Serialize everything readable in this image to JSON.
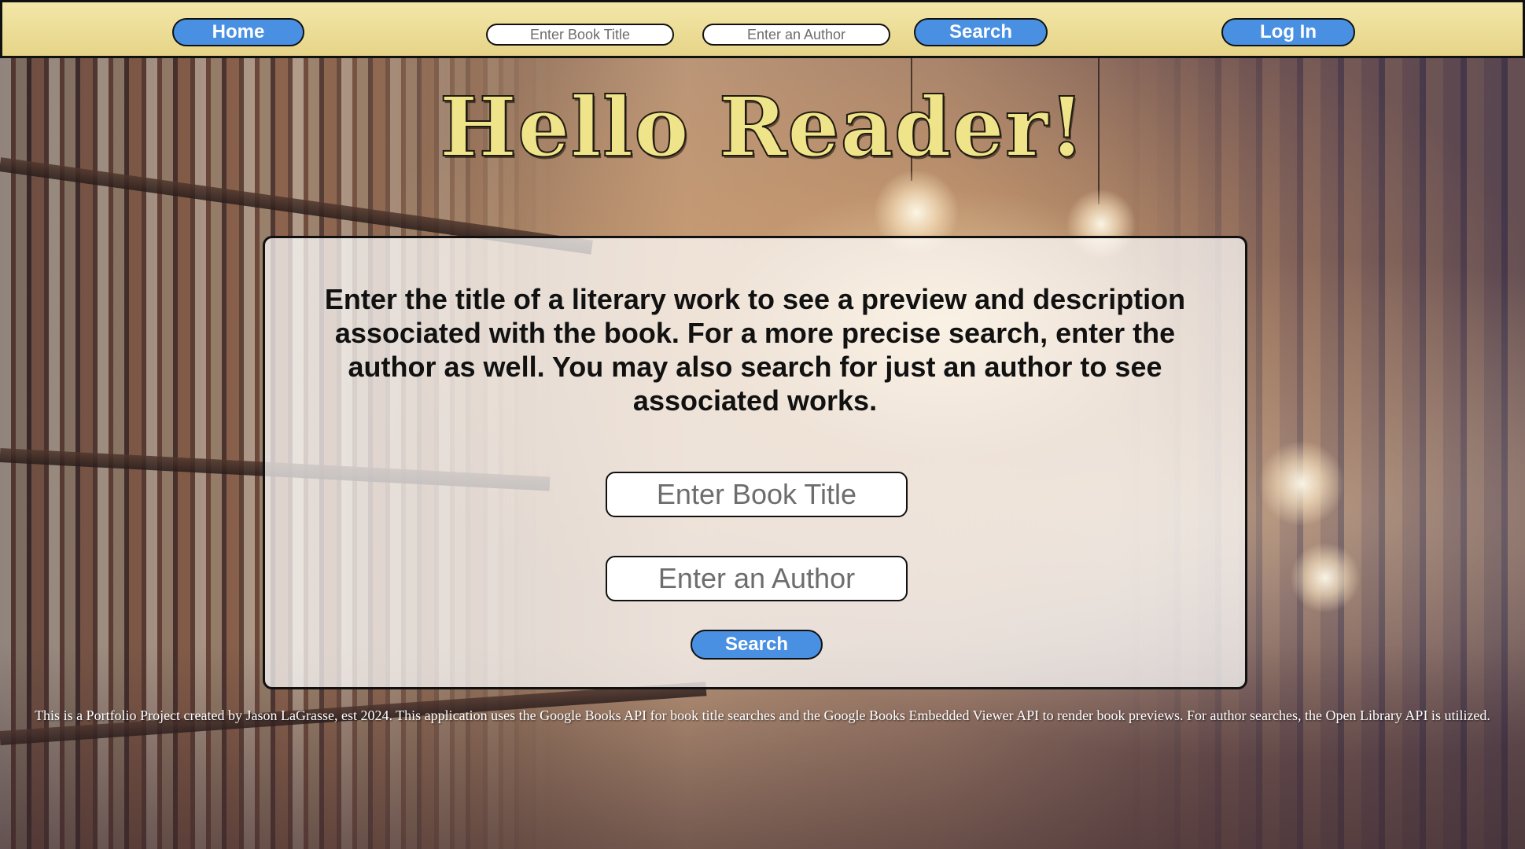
{
  "nav": {
    "home_label": "Home",
    "title_placeholder": "Enter Book Title",
    "author_placeholder": "Enter an Author",
    "search_label": "Search",
    "login_label": "Log In"
  },
  "hero": {
    "title": "Hello Reader!"
  },
  "card": {
    "description": "Enter the title of a literary work to see a preview and description associated with the book. For a more precise search, enter the author as well. You may also search for just an author to see associated works.",
    "title_placeholder": "Enter Book Title",
    "author_placeholder": "Enter an Author",
    "search_label": "Search"
  },
  "footer": {
    "text": "This is a Portfolio Project created by Jason LaGrasse, est 2024. This application uses the Google Books API for book title searches and the Google Books Embedded Viewer API to render book previews. For author searches, the Open Library API is utilized."
  },
  "colors": {
    "nav_background": "#efe19a",
    "button_blue": "#4a90e2",
    "title_yellow": "#efe48a"
  }
}
